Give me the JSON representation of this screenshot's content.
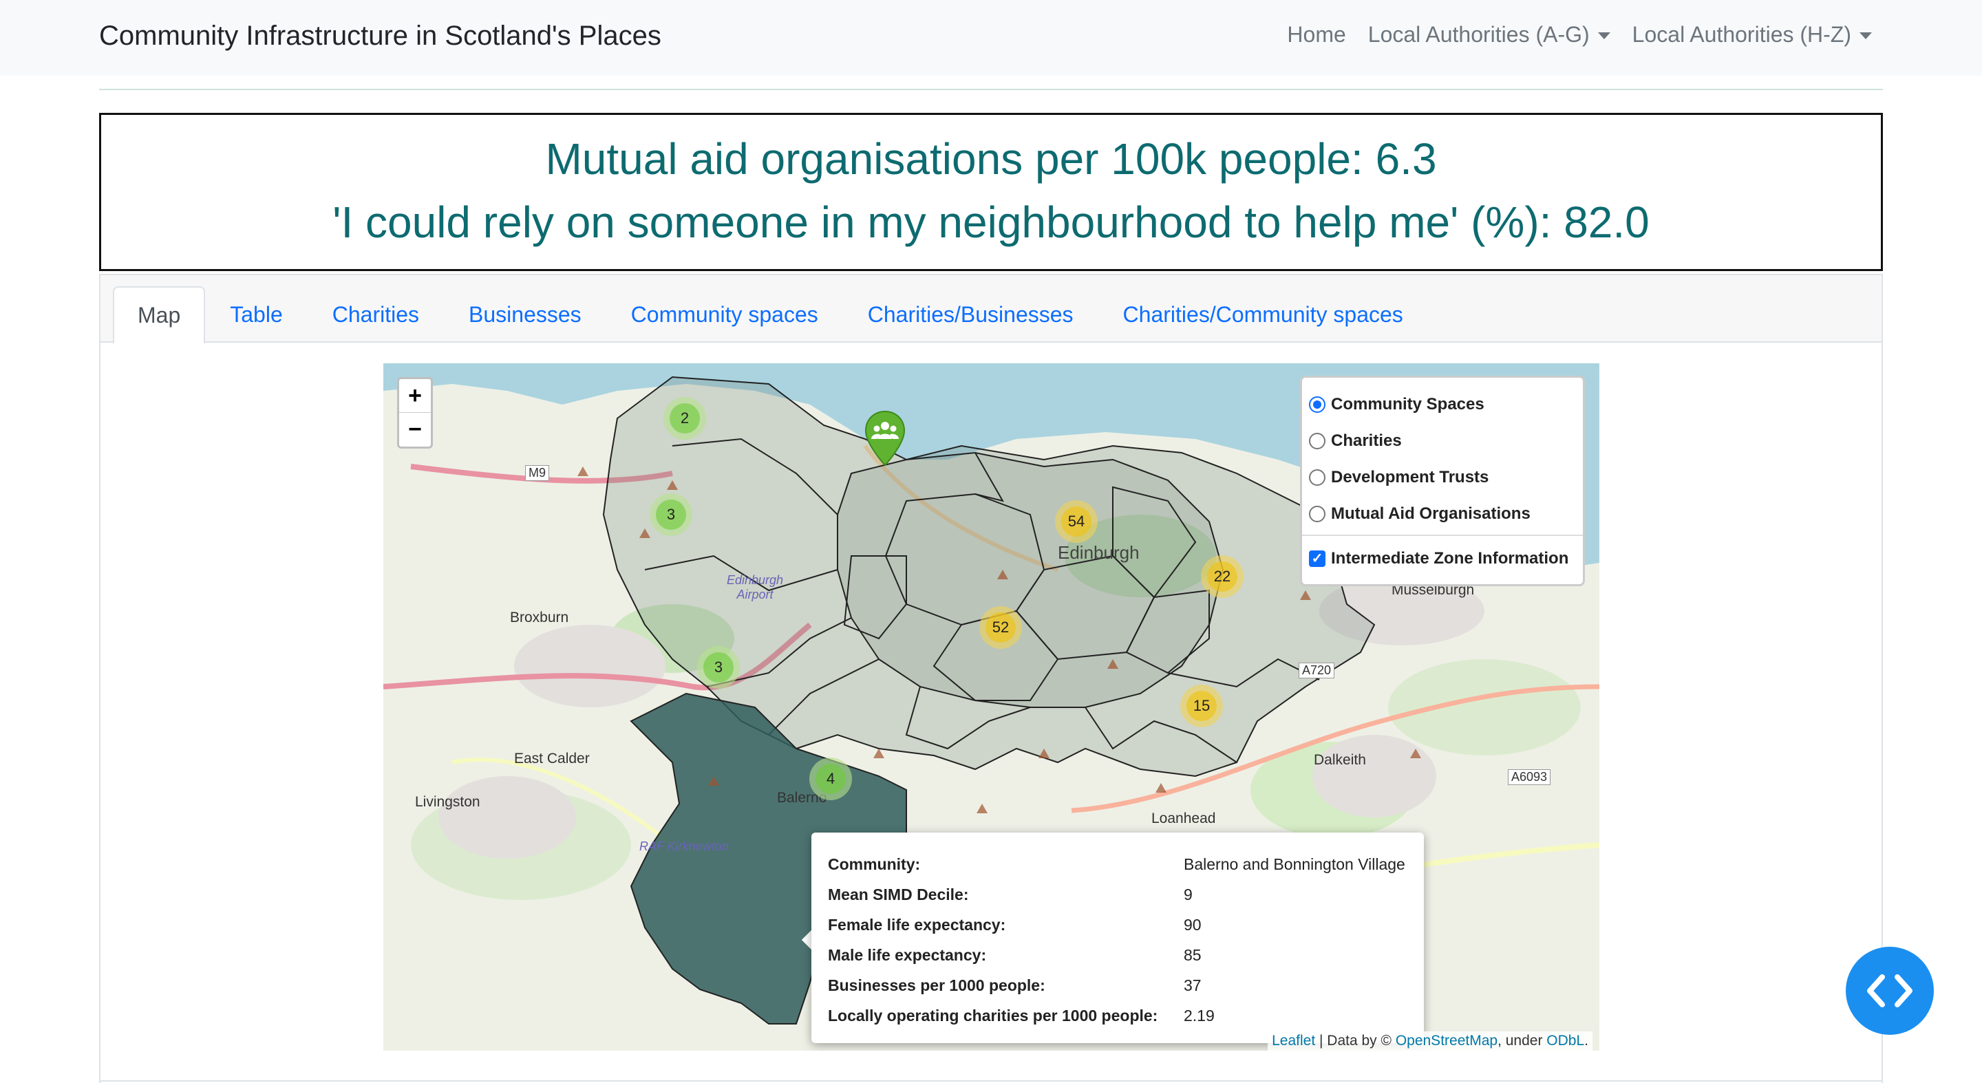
{
  "navbar": {
    "brand": "Community Infrastructure in Scotland's Places",
    "links": [
      "Home",
      "Local Authorities (A-G)",
      "Local Authorities (H-Z)"
    ]
  },
  "stats": {
    "line1": "Mutual aid organisations per 100k people: 6.3",
    "line2": "'I could rely on someone in my neighbourhood to help me' (%): 82.0"
  },
  "tabs": [
    "Map",
    "Table",
    "Charities",
    "Businesses",
    "Community spaces",
    "Charities/Businesses",
    "Charities/Community spaces"
  ],
  "map": {
    "zoom_in": "+",
    "zoom_out": "−",
    "layers": {
      "base": [
        "Community Spaces",
        "Charities",
        "Development Trusts",
        "Mutual Aid Organisations"
      ],
      "selected": "Community Spaces",
      "overlay": "Intermediate Zone Information",
      "overlay_checked": true
    },
    "clusters": [
      {
        "count": "2",
        "color": "green"
      },
      {
        "count": "3",
        "color": "green"
      },
      {
        "count": "3",
        "color": "green"
      },
      {
        "count": "4",
        "color": "green"
      },
      {
        "count": "54",
        "color": "yellow"
      },
      {
        "count": "22",
        "color": "yellow"
      },
      {
        "count": "52",
        "color": "yellow"
      },
      {
        "count": "15",
        "color": "yellow"
      }
    ],
    "place_labels": [
      "Broxburn",
      "East Calder",
      "Livingston",
      "Edinburgh Airport",
      "Musselburgh",
      "Dalkeith",
      "Loanhead",
      "Balerno",
      "RAF Kirknewton",
      "Edinburgh",
      "A720",
      "A6093",
      "M9"
    ],
    "popup": {
      "rows": [
        {
          "key": "Community:",
          "value": "Balerno and Bonnington Village"
        },
        {
          "key": "Mean SIMD Decile:",
          "value": "9"
        },
        {
          "key": "Female life expectancy:",
          "value": "90"
        },
        {
          "key": "Male life expectancy:",
          "value": "85"
        },
        {
          "key": "Businesses per 1000 people:",
          "value": "37"
        },
        {
          "key": "Locally operating charities per 1000 people:",
          "value": "2.19"
        }
      ]
    },
    "attribution": {
      "leaflet": "Leaflet",
      "sep": " | Data by © ",
      "osm": "OpenStreetMap",
      "under": ", under ",
      "odbl": "ODbL",
      "end": "."
    }
  },
  "colors": {
    "stat_text": "#0d6b70",
    "tab_link": "#0d6efd",
    "fab": "#1a8ff0",
    "highlight_area": "#2f5d5a",
    "sea": "#aad3df"
  }
}
